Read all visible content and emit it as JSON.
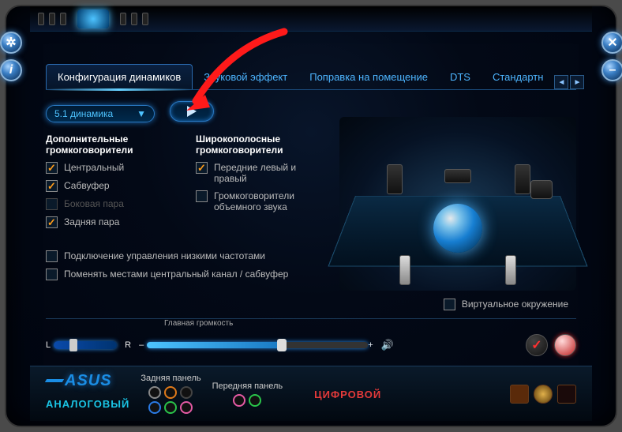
{
  "tabs": {
    "active": "Конфигурация динамиков",
    "t1": "Звуковой эффект",
    "t2": "Поправка на помещение",
    "t3": "DTS",
    "t4": "Стандартн"
  },
  "dropdown": {
    "value": "5.1 динамика"
  },
  "col1": {
    "head": "Дополнительные громкоговорители",
    "c0": "Центральный",
    "c1": "Сабвуфер",
    "c2": "Боковая пара",
    "c3": "Задняя пара"
  },
  "col2": {
    "head": "Широкополосные громкоговорители",
    "c0": "Передние левый и правый",
    "c1": "Громкоговорители объемного звука"
  },
  "wide": {
    "c0": "Подключение управления низкими частотами",
    "c1": "Поменять местами центральный канал / сабвуфер"
  },
  "virt": "Виртуальное окружение",
  "vol": {
    "label": "Главная громкость",
    "L": "L",
    "R": "R",
    "plus": "+"
  },
  "brand": "ASUS",
  "panels": {
    "rear": "Задняя панель",
    "front": "Передняя панель"
  },
  "modes": {
    "analog": "АНАЛОГОВЫЙ",
    "digital": "ЦИФРОВОЙ"
  }
}
